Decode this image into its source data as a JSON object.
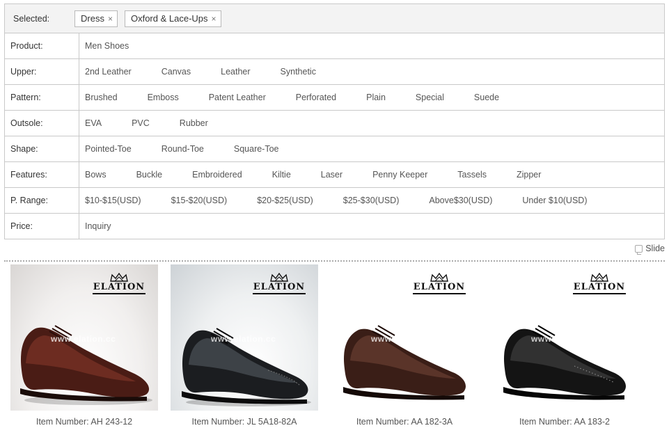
{
  "filters": {
    "selected_label": "Selected:",
    "chips": [
      {
        "label": "Dress",
        "remove": "×"
      },
      {
        "label": "Oxford & Lace-Ups",
        "remove": "×"
      }
    ],
    "rows": [
      {
        "label": "Product:",
        "options": [
          "Men Shoes"
        ]
      },
      {
        "label": "Upper:",
        "options": [
          "2nd Leather",
          "Canvas",
          "Leather",
          "Synthetic"
        ]
      },
      {
        "label": "Pattern:",
        "options": [
          "Brushed",
          "Emboss",
          "Patent Leather",
          "Perforated",
          "Plain",
          "Special",
          "Suede"
        ]
      },
      {
        "label": "Outsole:",
        "options": [
          "EVA",
          "PVC",
          "Rubber"
        ]
      },
      {
        "label": "Shape:",
        "options": [
          "Pointed-Toe",
          "Round-Toe",
          "Square-Toe"
        ]
      },
      {
        "label": "Features:",
        "options": [
          "Bows",
          "Buckle",
          "Embroidered",
          "Kiltie",
          "Laser",
          "Penny Keeper",
          "Tassels",
          "Zipper"
        ]
      },
      {
        "label": "P. Range:",
        "options": [
          "$10-$15(USD)",
          "$15-$20(USD)",
          "$20-$25(USD)",
          "$25-$30(USD)",
          "Above$30(USD)",
          "Under $10(USD)"
        ]
      },
      {
        "label": "Price:",
        "options": [
          "Inquiry"
        ]
      }
    ]
  },
  "slide_label": "Slide",
  "products": [
    {
      "brand": "ELATION",
      "watermark": "www.elation.cc",
      "caption": "Item Number: AH 243-12",
      "shoe_color": "#4a1c15",
      "shoe_highlight": "#8a3a2c"
    },
    {
      "brand": "ELATION",
      "watermark": "www.elation.cc",
      "caption": "Item Number: JL 5A18-82A",
      "shoe_color": "#1b1d20",
      "shoe_highlight": "#5a6068"
    },
    {
      "brand": "ELATION",
      "watermark": "www.elation.cc",
      "caption": "Item Number: AA 182-3A",
      "shoe_color": "#3a1e17",
      "shoe_highlight": "#7a4a3c"
    },
    {
      "brand": "ELATION",
      "watermark": "www.elation.cc",
      "caption": "Item Number: AA 183-2",
      "shoe_color": "#141414",
      "shoe_highlight": "#4e4e4e"
    }
  ]
}
